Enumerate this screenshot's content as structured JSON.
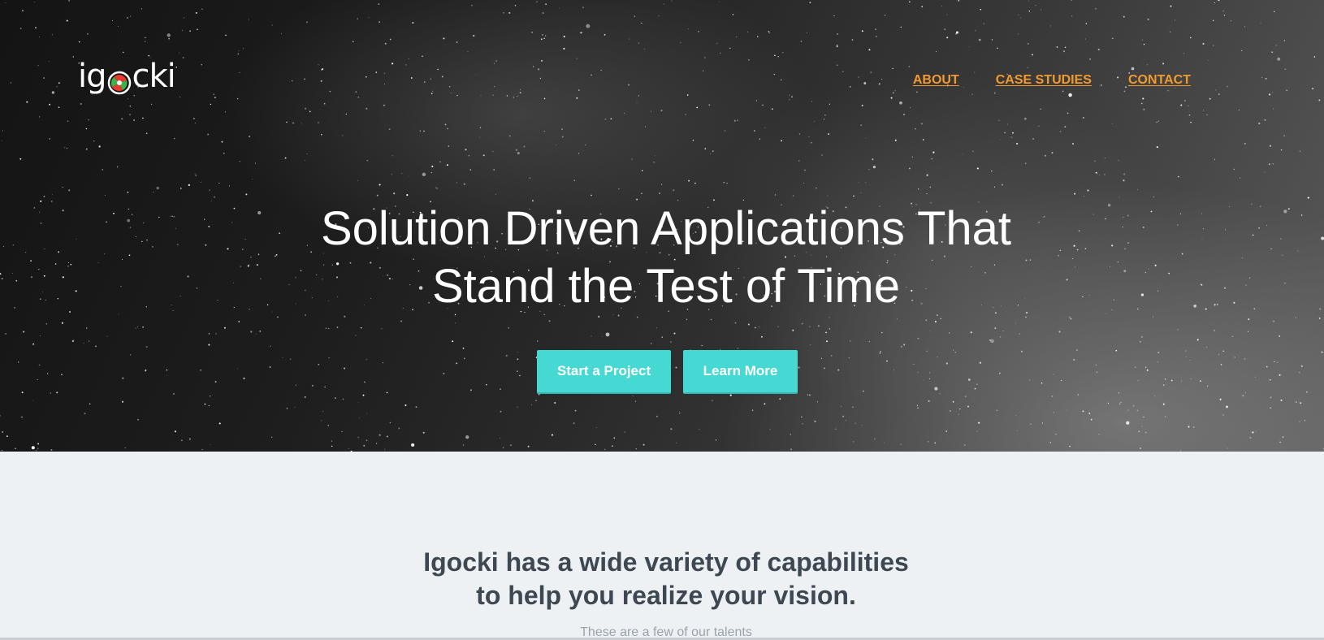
{
  "brand": {
    "logo_text_left": "ig",
    "logo_text_right": "cki",
    "logo_colors": [
      "#e63a2e",
      "#3bb54a",
      "#ffffff"
    ]
  },
  "nav": {
    "items": [
      {
        "label": "ABOUT"
      },
      {
        "label": "CASE STUDIES"
      },
      {
        "label": "CONTACT"
      }
    ],
    "color": "#f29a2e"
  },
  "hero": {
    "title_line1": "Solution Driven Applications That",
    "title_line2": "Stand the Test of Time",
    "buttons": {
      "start_label": "Start a Project",
      "learn_label": "Learn More"
    },
    "button_color": "#46d8d3"
  },
  "capabilities": {
    "title_line1": "Igocki has a wide variety of capabilities",
    "title_line2": "to help you realize your vision.",
    "subtitle": "These are a few of our talents"
  }
}
